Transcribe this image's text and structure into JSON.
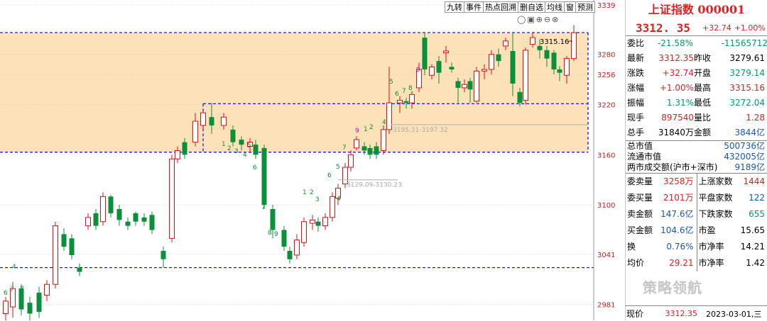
{
  "toolbar": [
    "九转",
    "事件",
    "热点回溯",
    "删自选",
    "均线",
    "窗",
    "预测"
  ],
  "toolbar_icons": [
    "eye-icon",
    "lock-icon",
    "zoom-in-icon",
    "zoom-out-icon",
    "close-icon"
  ],
  "chart_data": {
    "type": "candlestick",
    "ylim": [
      2962,
      3345
    ],
    "y_ticks": [
      "3339",
      "3280",
      "3256",
      "3220",
      "3160",
      "3100",
      "3041",
      "2981"
    ],
    "annotations": {
      "high_label": "3315.16",
      "gap1": "3195.31-3197.32",
      "gap2": "3129.09-3130.23"
    },
    "zones": [
      {
        "top": 3306,
        "bottom": 3163,
        "x_start": 0
      },
      {
        "top": 3216,
        "bottom": 3163,
        "x_start": 0.345
      }
    ],
    "dashed_levels": [
      3306,
      3221,
      3163,
      3025
    ]
  },
  "header": {
    "title": "上证指数 000001",
    "price": "3312. 35",
    "change": "+32.74",
    "pct": "+1.00%"
  },
  "quote_rows": [
    {
      "l": "委比",
      "v": "-21.58%",
      "l2": "",
      "v2": "-11565712",
      "c": "g",
      "c2": "g"
    },
    {
      "l": "最新",
      "v": "3312.35",
      "l2": "昨收",
      "v2": "3279.61",
      "c": "r",
      "c2": "k"
    },
    {
      "l": "涨跌",
      "v": "+32.74",
      "l2": "开盘",
      "v2": "3279.14",
      "c": "r",
      "c2": "g"
    },
    {
      "l": "涨幅",
      "v": "+1.00%",
      "l2": "最高",
      "v2": "3315.16",
      "c": "r",
      "c2": "r"
    },
    {
      "l": "振幅",
      "v": "1.31%",
      "l2": "最低",
      "v2": "3272.04",
      "c": "g",
      "c2": "g"
    },
    {
      "l": "现手",
      "v": "897540",
      "l2": "量比",
      "v2": "1.28",
      "c": "r",
      "c2": "r"
    },
    {
      "l": "总手",
      "v": "31840万",
      "l2": "金额",
      "v2": "3844亿",
      "c": "k",
      "c2": "blue"
    }
  ],
  "market_rows": [
    {
      "l": "总市值",
      "v": "500736亿"
    },
    {
      "l": "流通市值",
      "v": "432005亿"
    },
    {
      "l": "两市成交额(沪市+深市)",
      "v": "9189亿"
    }
  ],
  "left_rows": [
    {
      "l": "委卖量",
      "v": "3258万",
      "c": "r"
    },
    {
      "l": "委买量",
      "v": "2101万",
      "c": "r"
    },
    {
      "l": "卖金额",
      "v": "147.6亿",
      "c": "blue"
    },
    {
      "l": "买金额",
      "v": "104.6亿",
      "c": "blue"
    },
    {
      "l": "换",
      "v": "0.76%",
      "c": "blue"
    },
    {
      "l": "均价",
      "v": "29.21",
      "c": "r"
    }
  ],
  "right_rows": [
    {
      "l": "上涨家数",
      "v": "1444",
      "c": "r"
    },
    {
      "l": "平盘家数",
      "v": "122",
      "c": "blue"
    },
    {
      "l": "下跌家数",
      "v": "655",
      "c": "g"
    },
    {
      "l": "市盈",
      "v": "15.65",
      "c": "k"
    },
    {
      "l": "市净率",
      "v": "14.21",
      "c": "k"
    },
    {
      "l": "市净率",
      "v": "1.42",
      "c": "k"
    }
  ],
  "watermark": "策略领航",
  "footer": {
    "label": "现价",
    "value": "3312.35",
    "date": "2023-03-01,三"
  }
}
